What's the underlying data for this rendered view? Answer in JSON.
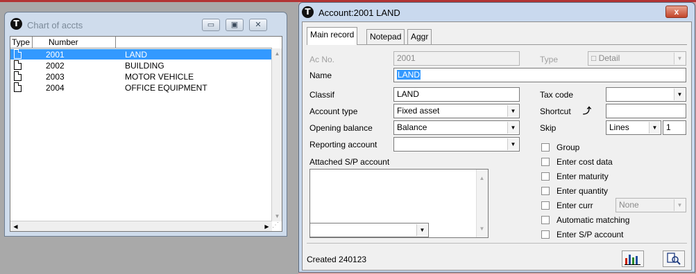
{
  "chart_window": {
    "title": "Chart of accts",
    "columns": [
      "Type",
      "Number"
    ],
    "rows": [
      {
        "number": "2001",
        "name": "LAND"
      },
      {
        "number": "2002",
        "name": "BUILDING"
      },
      {
        "number": "2003",
        "name": "MOTOR VEHICLE"
      },
      {
        "number": "2004",
        "name": "OFFICE EQUIPMENT"
      }
    ]
  },
  "account_window": {
    "title": "Account:2001 LAND",
    "close_label": "x",
    "tabs": [
      "Main record",
      "Notepad",
      "Aggr"
    ],
    "ac_no_label": "Ac No.",
    "ac_no_value": "2001",
    "type_label": "Type",
    "type_value": "Detail",
    "name_label": "Name",
    "name_value": "LAND",
    "classif_label": "Classif",
    "classif_value": "LAND",
    "account_type_label": "Account type",
    "account_type_value": "Fixed asset",
    "opening_balance_label": "Opening balance",
    "opening_balance_value": "Balance",
    "reporting_account_label": "Reporting account",
    "attached_sp_label": "Attached S/P account",
    "tax_code_label": "Tax code",
    "shortcut_label": "Shortcut",
    "skip_label": "Skip",
    "skip_value": "Lines",
    "skip_count": "1",
    "checkboxes": [
      "Group",
      "Enter cost data",
      "Enter maturity",
      "Enter quantity",
      "Enter curr",
      "Automatic matching",
      "Enter S/P account"
    ],
    "currency_value": "None",
    "status": "Created 240123"
  }
}
